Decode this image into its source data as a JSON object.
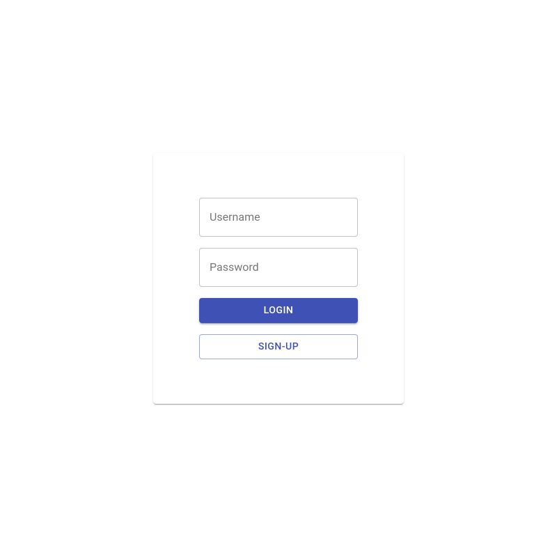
{
  "form": {
    "username": {
      "label": "Username",
      "value": ""
    },
    "password": {
      "label": "Password",
      "value": ""
    },
    "login_label": "Login",
    "signup_label": "Sign-up"
  },
  "colors": {
    "primary": "#3f51b5"
  }
}
